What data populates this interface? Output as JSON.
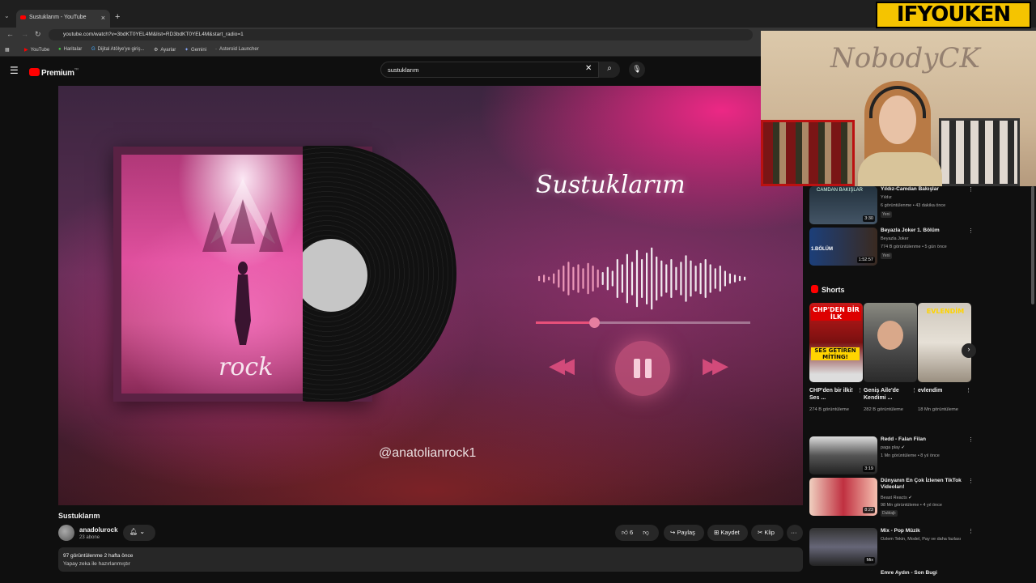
{
  "browser": {
    "tab_title": "Sustuklarım - YouTube",
    "url": "youtube.com/watch?v=3bdKT0YEL4M&list=RD3bdKT0YEL4M&start_radio=1",
    "bookmarks": [
      "YouTube",
      "Haritalar",
      "Dijital Atölye'ye giriş...",
      "Ayarlar",
      "Gemini",
      "Asteroid Launcher"
    ]
  },
  "header": {
    "logo": "Premium",
    "logo_region": "TR",
    "search_value": "sustuklarım"
  },
  "player": {
    "song_title": "Sustuklarım",
    "cover_text": "rock",
    "handle": "@anatolianrock1",
    "progress": 0.27,
    "waveform": [
      4,
      6,
      3,
      8,
      14,
      20,
      26,
      18,
      22,
      16,
      24,
      20,
      14,
      10,
      18,
      12,
      30,
      22,
      38,
      26,
      44,
      30,
      40,
      48,
      34,
      28,
      22,
      30,
      18,
      26,
      36,
      28,
      20,
      24,
      30,
      22,
      16,
      20,
      12,
      8,
      6,
      4,
      3
    ]
  },
  "video": {
    "title": "Sustuklarım",
    "channel": "anadolurock",
    "subscribers": "23 abone",
    "likes": "6",
    "share": "Paylaş",
    "save": "Kaydet",
    "clip": "Klip",
    "views": "97 görüntülenme  2 hafta önce",
    "description": "Yapay zeka ile hazırlanmıştır"
  },
  "webcam": {
    "name": "NobodyCK",
    "brand": "IFYOUKEN"
  },
  "sidebar": {
    "recs_top": [
      {
        "title": "Yıldız-Camdan Bakışlar",
        "channel": "Yıldız",
        "meta": "6 görüntülenme • 43 dakika önce",
        "badge": "Yeni",
        "duration": "3:30",
        "thumb_text": "CAMDAN BAKIŞLAR"
      },
      {
        "title": "Beyazla Joker 1. Bölüm",
        "channel": "Beyazla Joker",
        "meta": "774 B görüntülenme • 5 gün önce",
        "badge": "Yeni",
        "duration": "1:52:57",
        "thumb_text": "1.BÖLÜM"
      }
    ],
    "shorts_heading": "Shorts",
    "shorts": [
      {
        "title": "CHP'den bir ilki! Ses ...",
        "views": "274 B görüntüleme",
        "overlay1": "CHP'DEN BİR İLK",
        "overlay2": "SES GETİREN MİTİNG!"
      },
      {
        "title": "Geniş Aile'de Kendimi ...",
        "views": "282 B görüntüleme",
        "overlay1": "",
        "overlay2": ""
      },
      {
        "title": "evlendim",
        "views": "18 Mn görüntüleme",
        "overlay1": "EVLENDİM",
        "overlay2": ""
      }
    ],
    "recs_bottom": [
      {
        "title": "Redd - Falan Filan",
        "channel": "paga play ✔",
        "meta": "1 Mn görüntüleme • 8 yıl önce",
        "duration": "3:19",
        "badge": ""
      },
      {
        "title": "Dünyanın En Çok İzlenen TikTok Videoları!",
        "channel": "Beast Reacts ✔",
        "meta": "98 Mn görüntüleme • 4 yıl önce",
        "duration": "8:23",
        "badge": "Dublajlı"
      },
      {
        "title": "Mix - Pop Müzik",
        "channel": "Özlem Tekin, Model, Pay ve daha fazlası",
        "meta": "",
        "duration": "Mix",
        "badge": ""
      },
      {
        "title": "Emre Aydın - Son Bugi",
        "channel": "",
        "meta": "",
        "duration": "",
        "badge": ""
      }
    ]
  },
  "colors": {
    "accent": "#ff0000",
    "bg": "#0f0f0f",
    "pink": "#e8507a"
  }
}
